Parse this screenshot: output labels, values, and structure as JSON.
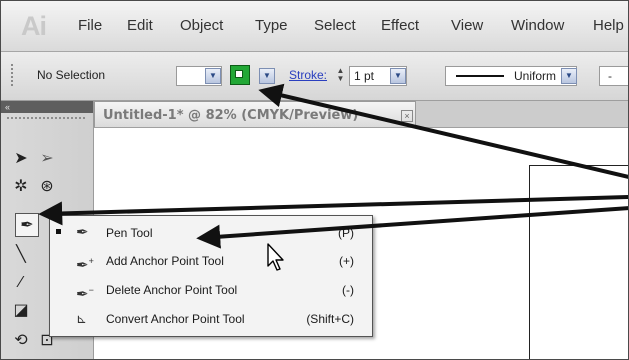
{
  "app": {
    "logo": "Ai"
  },
  "menu": [
    "File",
    "Edit",
    "Object",
    "Type",
    "Select",
    "Effect",
    "View",
    "Window",
    "Help"
  ],
  "control_bar": {
    "selection_status": "No Selection",
    "stroke_label": "Stroke:",
    "stroke_weight": "1 pt",
    "profile": "Uniform",
    "dash": "-",
    "stroke_color": "#22a836"
  },
  "tools_panel": {
    "collapse_label": "«"
  },
  "document": {
    "tab_title": "Untitled-1* @ 82% (CMYK/Preview)",
    "close": "×"
  },
  "flyout": {
    "items": [
      {
        "label": "Pen Tool",
        "shortcut": "(P)",
        "icon": "pen-icon",
        "selected": true
      },
      {
        "label": "Add Anchor Point Tool",
        "shortcut": "(+)",
        "icon": "add-anchor-point-icon",
        "selected": false
      },
      {
        "label": "Delete Anchor Point Tool",
        "shortcut": "(-)",
        "icon": "delete-anchor-point-icon",
        "selected": false
      },
      {
        "label": "Convert Anchor Point Tool",
        "shortcut": "(Shift+C)",
        "icon": "convert-anchor-point-icon",
        "selected": false
      }
    ]
  },
  "colors": {
    "arrow": "#111111",
    "accent_link": "#2a3fbf",
    "toolbar_bg": "#d6d6d6"
  }
}
